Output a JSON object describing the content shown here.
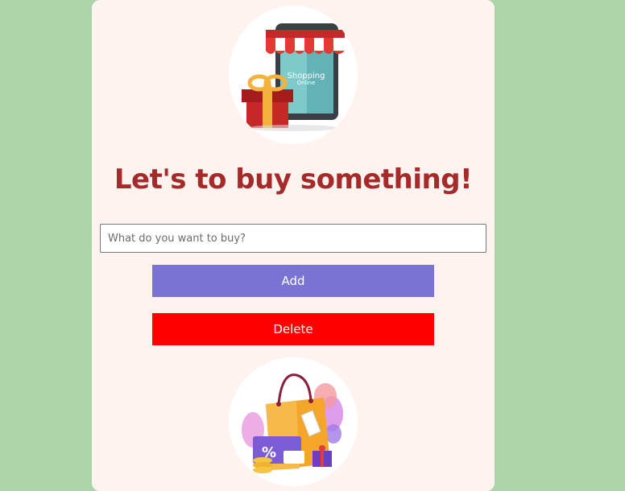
{
  "header": {
    "title": "Let's to buy something!"
  },
  "hero": {
    "phone_text_line1": "Shopping",
    "phone_text_line2": "Online",
    "discount_symbol": "%"
  },
  "form": {
    "input_placeholder": "What do you want to buy?",
    "input_value": "",
    "add_label": "Add",
    "delete_label": "Delete"
  },
  "colors": {
    "page_background": "#acd4a8",
    "card_background": "#fff3f0",
    "title": "#a52a2a",
    "add_button": "#7b73d3",
    "delete_button": "#ff0000"
  }
}
